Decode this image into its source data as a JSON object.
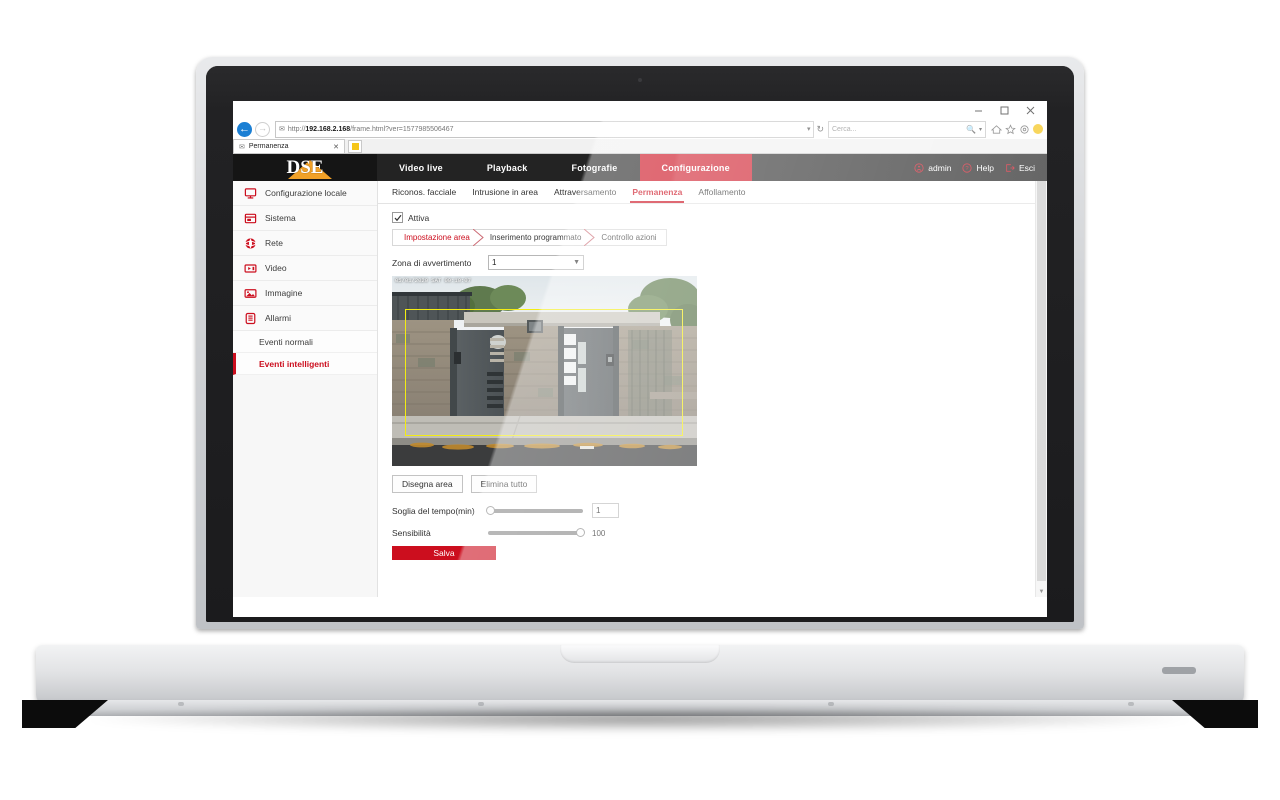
{
  "browser": {
    "tab_title": "Permanenza",
    "url_lock_icon": "page-icon",
    "url_host": "192.168.2.168",
    "url_path": "/frame.html?ver=1577985506467",
    "url_prefix": "http://",
    "search_placeholder": "Cerca...",
    "minimize_label": "–",
    "maximize_label": "❑",
    "close_label": "✕",
    "tab_close_label": "✕",
    "back_label": "←",
    "forward_label": "→",
    "refresh_label": "↻",
    "address_caret": "▾",
    "search_caret": "▾"
  },
  "topnav": {
    "logo_text": "DSE",
    "items": [
      {
        "label": "Video live",
        "active": false
      },
      {
        "label": "Playback",
        "active": false
      },
      {
        "label": "Fotografie",
        "active": false
      },
      {
        "label": "Configurazione",
        "active": true
      }
    ],
    "user": "admin",
    "help": "Help",
    "logout": "Esci"
  },
  "sidebar": {
    "items": [
      {
        "label": "Configurazione locale",
        "icon": "monitor-icon"
      },
      {
        "label": "Sistema",
        "icon": "system-icon"
      },
      {
        "label": "Rete",
        "icon": "network-icon"
      },
      {
        "label": "Video",
        "icon": "video-icon"
      },
      {
        "label": "Immagine",
        "icon": "image-icon"
      },
      {
        "label": "Allarmi",
        "icon": "alarm-icon"
      }
    ],
    "subitems": [
      {
        "label": "Eventi normali",
        "active": false
      },
      {
        "label": "Eventi intelligenti",
        "active": true
      }
    ]
  },
  "main": {
    "tabs": [
      {
        "label": "Riconos. facciale",
        "active": false
      },
      {
        "label": "Intrusione in area",
        "active": false
      },
      {
        "label": "Attraversamento",
        "active": false
      },
      {
        "label": "Permanenza",
        "active": true
      },
      {
        "label": "Affollamento",
        "active": false
      }
    ],
    "enable_checkbox_label": "Attiva",
    "enable_checkbox_checked": true,
    "crumbs": [
      {
        "label": "Impostazione area",
        "active": true
      },
      {
        "label": "Inserimento programmato",
        "active": false
      },
      {
        "label": "Controllo azioni",
        "active": false
      }
    ],
    "zone_label": "Zona di avvertimento",
    "zone_value": "1",
    "video_osd": "05/01/2020 SAT 09:10:07",
    "buttons": {
      "draw_area": "Disegna area",
      "delete_all": "Elimina tutto",
      "save": "Salva"
    },
    "sliders": [
      {
        "label": "Soglia del tempo(min)",
        "value": "1",
        "percent": 0,
        "boxed": true
      },
      {
        "label": "Sensibilità",
        "value": "100",
        "percent": 100,
        "boxed": false
      }
    ]
  },
  "colors": {
    "brand_red": "#cc0e1e",
    "logo_orange": "#f2a127",
    "nav_dark": "#232323",
    "draw_yellow": "#f2ec12"
  }
}
